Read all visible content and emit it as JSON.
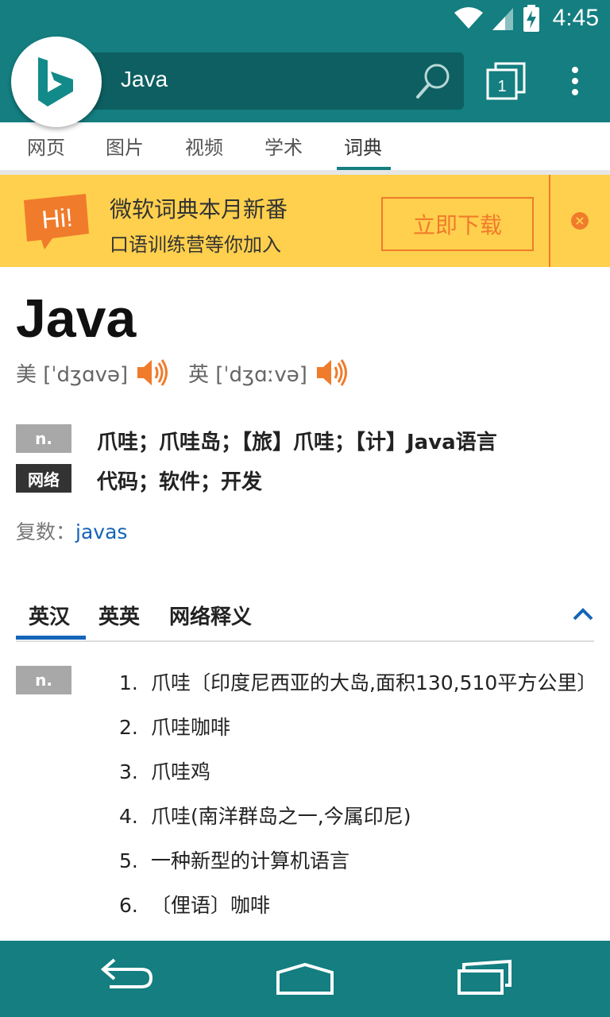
{
  "status_bar": {
    "time": "4:45"
  },
  "header": {
    "search_value": "Java",
    "tabs_count": "1"
  },
  "nav_tabs": [
    {
      "label": "网页"
    },
    {
      "label": "图片"
    },
    {
      "label": "视频"
    },
    {
      "label": "学术"
    },
    {
      "label": "词典",
      "active": true
    }
  ],
  "banner": {
    "badge": "Hi!",
    "title": "微软词典本月新番",
    "subtitle": "口语训练营等你加入",
    "button": "立即下载"
  },
  "entry": {
    "word": "Java",
    "pron_us": "美 [ˈdʒɑvə]",
    "pron_uk": "英 [ˈdʒɑːvə]",
    "definitions": [
      {
        "pos": "n.",
        "text": "爪哇；爪哇岛；【旅】爪哇；【计】Java语言"
      },
      {
        "pos": "网络",
        "text": "代码；软件；开发"
      }
    ],
    "plural_label": "复数：",
    "plural_value": "javas"
  },
  "sub_tabs": [
    {
      "label": "英汉",
      "active": true
    },
    {
      "label": "英英"
    },
    {
      "label": "网络释义"
    }
  ],
  "detail": {
    "pos": "n.",
    "items": [
      {
        "num": "1.",
        "text": "爪哇〔印度尼西亚的大岛,面积130,510平方公里〕"
      },
      {
        "num": "2.",
        "text": "爪哇咖啡"
      },
      {
        "num": "3.",
        "text": "爪哇鸡"
      },
      {
        "num": "4.",
        "text": "爪哇(南洋群岛之一,今属印尼)"
      },
      {
        "num": "5.",
        "text": "一种新型的计算机语言"
      },
      {
        "num": "6.",
        "text": "〔俚语〕咖啡"
      }
    ]
  },
  "colors": {
    "brand_teal": "#147e80",
    "banner_yellow": "#ffd04d",
    "accent_orange": "#f07b2b",
    "link_blue": "#1463b8"
  }
}
